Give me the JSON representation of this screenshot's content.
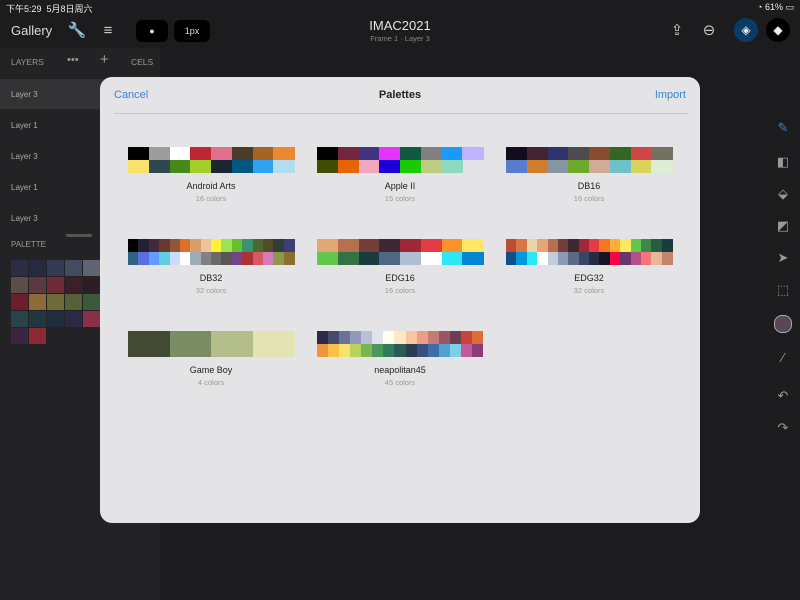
{
  "status": {
    "time": "下午5:29",
    "date": "5月8日周六",
    "battery": "61%"
  },
  "toolbar": {
    "gallery": "Gallery",
    "brush_size": "1px",
    "title": "IMAC2021",
    "subtitle": "Frame 1 · Layer 3"
  },
  "layers_panel": {
    "layers_label": "LAYERS",
    "more": "•••",
    "add": "+",
    "cels_label": "CELS",
    "layers": [
      "Layer 3",
      "Layer 1",
      "Layer 3",
      "Layer 1",
      "Layer 3"
    ],
    "palette_label": "PALETTE",
    "palette_colors": [
      "#2b2d44",
      "#262a41",
      "#353a52",
      "#444a60",
      "#5e6474",
      "#8b8270",
      "#726b5d",
      "#5b4e46",
      "#5a3a3f",
      "#6e2c36",
      "#3b2026",
      "#2d1e26",
      "#36222c",
      "#4b2433",
      "#6b1f2c",
      "#8c6b3a",
      "#6f6a3a",
      "#55603a",
      "#3b5a3c",
      "#2f4a3c",
      "#2c3a3b",
      "#274449",
      "#223642",
      "#1f2e3a",
      "#2a2a46",
      "#8a2f4a",
      "#6a2f49",
      "#4e2946",
      "#3a243f",
      "#8c2a34"
    ]
  },
  "sheet": {
    "cancel": "Cancel",
    "title": "Palettes",
    "import": "Import",
    "palettes": [
      {
        "name": "Android Arts",
        "count": "16 colors",
        "row1": [
          "#000000",
          "#9d9d9d",
          "#ffffff",
          "#be2633",
          "#e06f8b",
          "#493c2b",
          "#a46422",
          "#eb8931"
        ],
        "row2": [
          "#f7e26b",
          "#2f484e",
          "#44891a",
          "#a3ce27",
          "#1b2632",
          "#005784",
          "#31a2f2",
          "#b2dcef"
        ]
      },
      {
        "name": "Apple II",
        "count": "15 colors",
        "row1": [
          "#000000",
          "#722640",
          "#40337f",
          "#e434fe",
          "#0e5940",
          "#808080",
          "#1b9afe",
          "#bfb3ff"
        ],
        "row2": [
          "#404c00",
          "#e46501",
          "#f1a6bf",
          "#1b00d8",
          "#1bcb01",
          "#bfcc80",
          "#8dd9bf",
          ""
        ]
      },
      {
        "name": "DB16",
        "count": "16 colors",
        "row1": [
          "#140c1c",
          "#442434",
          "#30346d",
          "#4e4a4e",
          "#854c30",
          "#346524",
          "#d04648",
          "#757161"
        ],
        "row2": [
          "#597dce",
          "#d27d2c",
          "#8595a1",
          "#6daa2c",
          "#d2aa99",
          "#6dc2ca",
          "#dad45e",
          "#deeed6"
        ]
      },
      {
        "name": "DB32",
        "count": "32 colors",
        "row1": [
          "#000000",
          "#222034",
          "#45283c",
          "#663931",
          "#8f563b",
          "#df7126",
          "#d9a066",
          "#eec39a",
          "#fbf236",
          "#99e550",
          "#6abe30",
          "#37946e",
          "#4b692f",
          "#524b24",
          "#323c39",
          "#3f3f74"
        ],
        "row2": [
          "#306082",
          "#5b6ee1",
          "#639bff",
          "#5fcde4",
          "#cbdbfc",
          "#ffffff",
          "#9badb7",
          "#847e87",
          "#696a6a",
          "#595652",
          "#76428a",
          "#ac3232",
          "#d95763",
          "#d77bba",
          "#8f974a",
          "#8a6f30"
        ]
      },
      {
        "name": "EDG16",
        "count": "16 colors",
        "row1": [
          "#e4a672",
          "#b86f50",
          "#743f39",
          "#3f2832",
          "#9e2835",
          "#e53b44",
          "#fb922b",
          "#ffe762"
        ],
        "row2": [
          "#63c64d",
          "#327345",
          "#193d3f",
          "#4f6781",
          "#afbfd2",
          "#ffffff",
          "#2ce8f4",
          "#0484d1"
        ]
      },
      {
        "name": "EDG32",
        "count": "32 colors",
        "row1": [
          "#be4a2f",
          "#d77643",
          "#ead4aa",
          "#e4a672",
          "#b86f50",
          "#733e39",
          "#3e2731",
          "#a22633",
          "#e43b44",
          "#f77622",
          "#feae34",
          "#fee761",
          "#63c74d",
          "#3e8948",
          "#265c42",
          "#193c3e"
        ],
        "row2": [
          "#124e89",
          "#0099db",
          "#2ce8f5",
          "#ffffff",
          "#c0cbdc",
          "#8b9bb4",
          "#5a6988",
          "#3a4466",
          "#262b44",
          "#181425",
          "#ff0044",
          "#68386c",
          "#b55088",
          "#f6757a",
          "#e8b796",
          "#c28569"
        ]
      },
      {
        "name": "Game Boy",
        "count": "4 colors",
        "row1": [
          "#434a33",
          "#7a8c64",
          "#b4bd8c",
          "#e3e3b4"
        ],
        "row2": [
          "#434a33",
          "#7a8c64",
          "#b4bd8c",
          "#e3e3b4"
        ]
      },
      {
        "name": "neapolitan45",
        "count": "45 colors",
        "row1": [
          "#2b2b45",
          "#474a6d",
          "#6c7197",
          "#939ab9",
          "#b9c0d6",
          "#dfe3ec",
          "#fffff0",
          "#ffe8c7",
          "#f7c69e",
          "#e89f83",
          "#c67a72",
          "#9a5763",
          "#6f3c56",
          "#c8433a",
          "#e06b3a"
        ],
        "row2": [
          "#f0943e",
          "#f5c24a",
          "#f7e26b",
          "#b6d35c",
          "#78b653",
          "#4c965a",
          "#347a5c",
          "#285c55",
          "#2a3c4f",
          "#3b4f7c",
          "#3d6fa9",
          "#54a0d0",
          "#7ccfe6",
          "#c05a9a",
          "#8a3d76"
        ]
      }
    ]
  }
}
